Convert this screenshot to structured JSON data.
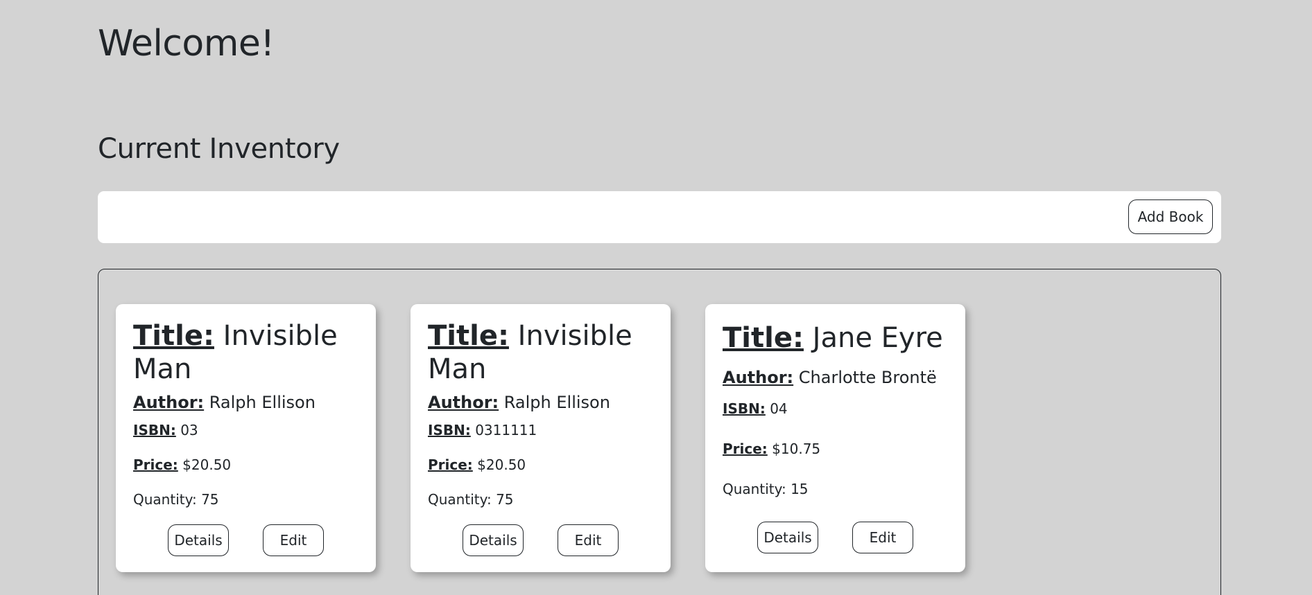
{
  "header": {
    "welcome": "Welcome!",
    "section_title": "Current Inventory"
  },
  "toolbar": {
    "add_book_label": "Add Book"
  },
  "labels": {
    "title": "Title:",
    "author": "Author:",
    "isbn": "ISBN:",
    "price": "Price:",
    "quantity": "Quantity:",
    "details_button": "Details",
    "edit_button": "Edit"
  },
  "books": [
    {
      "title": "Invisible Man",
      "author": "Ralph Ellison",
      "isbn": "03",
      "price": "$20.50",
      "quantity": "75"
    },
    {
      "title": "Invisible Man",
      "author": "Ralph Ellison",
      "isbn": "0311111",
      "price": "$20.50",
      "quantity": "75"
    },
    {
      "title": "Jane Eyre",
      "author": "Charlotte Brontë",
      "isbn": "04",
      "price": "$10.75",
      "quantity": "15"
    }
  ]
}
